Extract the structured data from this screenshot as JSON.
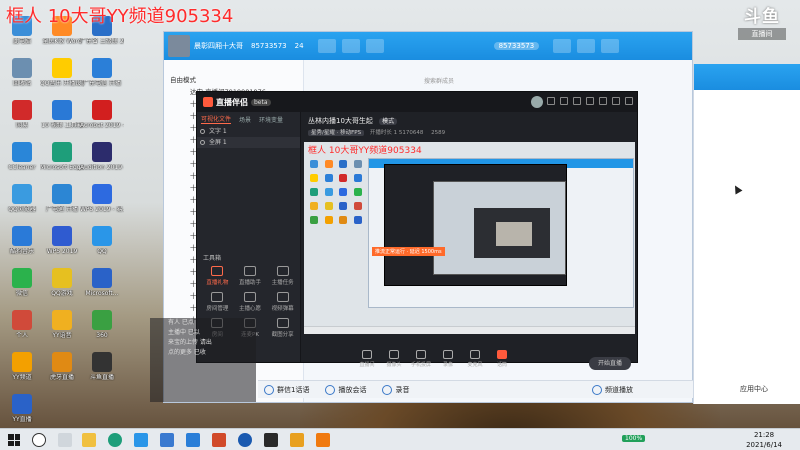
{
  "watermark": "框人 10大哥YY频道905334",
  "corner_logo": {
    "title": "斗鱼",
    "sub": "直播间"
  },
  "desktop_icons": [
    {
      "label": "此电脑",
      "color": "#3b8ed8"
    },
    {
      "label": "全民K歌 Word",
      "color": "#ff8a25"
    },
    {
      "label": "广东省 三级联 2021...",
      "color": "#2a6fc8"
    },
    {
      "label": "回收站",
      "color": "#6c8fb0"
    },
    {
      "label": "QQ音乐 开播设置",
      "color": "#ffcc00"
    },
    {
      "label": "广东电信 开播",
      "color": "#2b7fd8"
    },
    {
      "label": "网易",
      "color": "#d12a2a"
    },
    {
      "label": "10 视频 工具箱",
      "color": "#2a79d6"
    },
    {
      "label": "Acrobat 2019 - 易...",
      "color": "#d21f1f"
    },
    {
      "label": "CCleaner",
      "color": "#2a86d8"
    },
    {
      "label": "Microsoft Edge",
      "color": "#1e9e7a"
    },
    {
      "label": "Audition 2019 - 易...",
      "color": "#2c2c6c"
    },
    {
      "label": "QQ浏览器",
      "color": "#3a9be0"
    },
    {
      "label": "广电通 开播",
      "color": "#2c86d4"
    },
    {
      "label": "WPS 2019 - 易...",
      "color": "#2d6ae0"
    },
    {
      "label": "酷狗音乐",
      "color": "#2a7ad8"
    },
    {
      "label": "WPS 2019",
      "color": "#2f5bd0"
    },
    {
      "label": "QQ",
      "color": "#2a96e8"
    },
    {
      "label": "微信",
      "color": "#2bb24c"
    },
    {
      "label": "QQ游戏",
      "color": "#e6c020"
    },
    {
      "label": "Microsoft...",
      "color": "#2a62c8"
    },
    {
      "label": "个人",
      "color": "#d04a3a"
    },
    {
      "label": "YY语音",
      "color": "#f0b020"
    },
    {
      "label": "360",
      "color": "#3aa042"
    },
    {
      "label": "YY频道",
      "color": "#f3a000"
    },
    {
      "label": "虎牙直播",
      "color": "#e08a14"
    },
    {
      "label": "斗鱼直播",
      "color": "#333"
    },
    {
      "label": "YY直播",
      "color": "#2a62c8"
    }
  ],
  "qq_window": {
    "title": "晨彰四厢十大哥",
    "group_id": "85733573",
    "members": "24",
    "badge": "85733573",
    "search_placeholder": "搜索群成员",
    "mode": "自由模式",
    "left_rows": [
      "达安 直播间7919981976",
      "十大哥",
      "十大哥",
      "十大哥",
      "十大哥",
      "十大哥",
      "十大哥",
      "十大哥",
      "十大哥",
      "十大哥",
      "十大哥",
      "十大哥",
      "十大哥",
      "十大哥",
      "十大哥",
      "十大哥",
      "十大哥",
      "十大哥",
      "十大哥",
      "十大哥",
      "十大哥"
    ]
  },
  "live_app": {
    "brand": "直播伴侣",
    "version": "beta",
    "tabs": [
      "可视化文件",
      "场景",
      "环境变量"
    ],
    "scenes": [
      "文字 1",
      "全屏 1"
    ],
    "toolbox_label": "工具箱",
    "tools": [
      "直播礼物",
      "直播助手",
      "主播任务",
      "房间管理",
      "主播心愿",
      "视频弹幕",
      "房间",
      "连麦PK",
      "截图分享"
    ],
    "room_title": "丛林内播10大哥生起",
    "room_tag": "模式",
    "room_meta_category": "星秀/星耀 · 移动FPS",
    "room_meta_info": "开播时长 1 5170648",
    "room_meta_viewers": "2589",
    "preview_watermark": "框人 10大哥YY频道905334",
    "preview_note": "推流正常运行 · 延迟 1500ms",
    "bottom_tools": [
      "直播间",
      "摄像头",
      "手机投屏",
      "录像",
      "麦克风",
      "话筒"
    ],
    "end_button": "开始直播"
  },
  "dark_overlay_lines": [
    "有人 已点",
    "主播中 已以",
    "来宝的上传 请出",
    "点的更多 已收"
  ],
  "chatbar": {
    "items": [
      "群信1话语",
      "播放会话",
      "录音"
    ],
    "right_item": "频道播放",
    "app_center": "应用中心"
  },
  "taskbar": {
    "time": "21:28",
    "date": "2021/6/14",
    "tray_badge": "100%"
  }
}
